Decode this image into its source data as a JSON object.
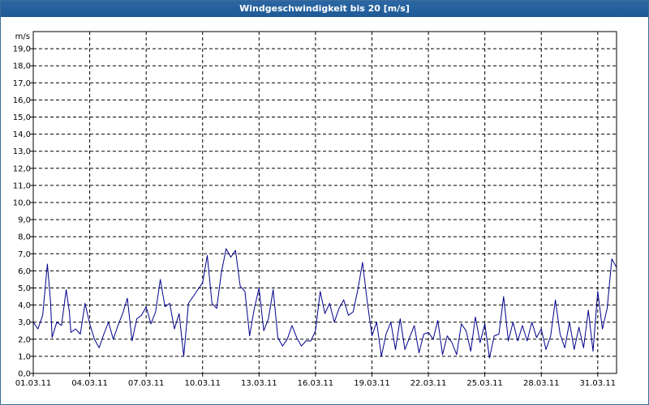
{
  "window": {
    "title": "Windgeschwindigkeit bis 20 [m/s]"
  },
  "colors": {
    "titlebar": "#1f5a96",
    "series": "#00008b",
    "grid": "#000000"
  },
  "chart_data": {
    "type": "line",
    "title": "Windgeschwindigkeit bis 20 [m/s]",
    "ylabel": "m/s",
    "xlabel": "",
    "ylim": [
      0,
      20
    ],
    "xlim": [
      "01.03.11",
      "01.04.11"
    ],
    "grid": true,
    "legend": "none",
    "yticks": [
      "0,0",
      "1,0",
      "2,0",
      "3,0",
      "4,0",
      "5,0",
      "6,0",
      "7,0",
      "8,0",
      "9,0",
      "10,0",
      "11,0",
      "12,0",
      "13,0",
      "14,0",
      "15,0",
      "16,0",
      "17,0",
      "18,0",
      "19,0"
    ],
    "xticks": [
      "01.03.11",
      "04.03.11",
      "07.03.11",
      "10.03.11",
      "13.03.11",
      "16.03.11",
      "19.03.11",
      "22.03.11",
      "25.03.11",
      "28.03.11",
      "31.03.11"
    ],
    "series": [
      {
        "x": [
          "01.03.11",
          "01.03.11",
          "01.03.11",
          "01.03.11",
          "01.03.11",
          "02.03.11",
          "02.03.11",
          "02.03.11",
          "02.03.11",
          "02.03.11",
          "03.03.11",
          "03.03.11",
          "03.03.11",
          "03.03.11",
          "04.03.11",
          "04.03.11",
          "04.03.11",
          "04.03.11",
          "05.03.11",
          "05.03.11",
          "05.03.11",
          "05.03.11",
          "06.03.11",
          "06.03.11",
          "06.03.11",
          "06.03.11",
          "07.03.11",
          "07.03.11",
          "07.03.11",
          "07.03.11",
          "08.03.11",
          "08.03.11",
          "08.03.11",
          "08.03.11",
          "09.03.11",
          "09.03.11",
          "09.03.11",
          "09.03.11",
          "10.03.11",
          "10.03.11",
          "10.03.11",
          "10.03.11",
          "11.03.11",
          "11.03.11",
          "11.03.11",
          "11.03.11",
          "12.03.11",
          "12.03.11",
          "12.03.11",
          "12.03.11",
          "13.03.11",
          "13.03.11",
          "13.03.11",
          "13.03.11",
          "14.03.11",
          "14.03.11",
          "14.03.11",
          "14.03.11",
          "15.03.11",
          "15.03.11",
          "15.03.11",
          "15.03.11",
          "16.03.11",
          "16.03.11",
          "16.03.11",
          "16.03.11",
          "17.03.11",
          "17.03.11",
          "17.03.11",
          "17.03.11",
          "18.03.11",
          "18.03.11",
          "18.03.11",
          "18.03.11",
          "19.03.11",
          "19.03.11",
          "19.03.11",
          "19.03.11",
          "20.03.11",
          "20.03.11",
          "20.03.11",
          "20.03.11",
          "21.03.11",
          "21.03.11",
          "21.03.11",
          "21.03.11",
          "22.03.11",
          "22.03.11",
          "22.03.11",
          "22.03.11",
          "23.03.11",
          "23.03.11",
          "23.03.11",
          "23.03.11",
          "24.03.11",
          "24.03.11",
          "24.03.11",
          "24.03.11",
          "25.03.11",
          "25.03.11",
          "25.03.11",
          "25.03.11",
          "26.03.11",
          "26.03.11",
          "26.03.11",
          "26.03.11",
          "27.03.11",
          "27.03.11",
          "27.03.11",
          "27.03.11",
          "28.03.11",
          "28.03.11",
          "28.03.11",
          "28.03.11",
          "29.03.11",
          "29.03.11",
          "29.03.11",
          "29.03.11",
          "30.03.11",
          "30.03.11",
          "30.03.11",
          "30.03.11",
          "31.03.11",
          "31.03.11",
          "31.03.11",
          "31.03.11",
          "01.04.11"
        ],
        "hours": [
          0,
          6,
          12,
          18,
          22,
          0,
          6,
          12,
          18,
          22,
          0,
          6,
          12,
          18,
          0,
          6,
          12,
          18,
          0,
          6,
          12,
          18,
          0,
          6,
          12,
          18,
          0,
          6,
          12,
          18,
          0,
          6,
          12,
          18,
          0,
          6,
          12,
          18,
          0,
          6,
          12,
          18,
          0,
          6,
          12,
          18,
          0,
          6,
          12,
          18,
          0,
          6,
          12,
          18,
          0,
          6,
          12,
          18,
          0,
          6,
          12,
          18,
          0,
          6,
          12,
          18,
          0,
          6,
          12,
          18,
          0,
          6,
          12,
          18,
          0,
          6,
          12,
          18,
          0,
          6,
          12,
          18,
          0,
          6,
          12,
          18,
          0,
          6,
          12,
          18,
          0,
          6,
          12,
          18,
          0,
          6,
          12,
          18,
          0,
          6,
          12,
          18,
          0,
          6,
          12,
          18,
          0,
          6,
          12,
          18,
          0,
          6,
          12,
          18,
          0,
          6,
          12,
          18,
          0,
          6,
          12,
          18,
          0,
          6,
          12,
          18,
          0
        ],
        "values": [
          3.0,
          2.6,
          3.4,
          6.4,
          4.2,
          2.1,
          3.0,
          2.8,
          4.9,
          3.6,
          2.4,
          2.6,
          2.3,
          4.1,
          2.9,
          2.0,
          1.5,
          2.3,
          3.0,
          2.0,
          2.8,
          3.5,
          4.4,
          1.9,
          3.2,
          3.4,
          3.9,
          2.9,
          3.6,
          5.5,
          3.9,
          4.1,
          2.6,
          3.5,
          1.0,
          4.1,
          4.5,
          4.9,
          5.3,
          6.9,
          4.1,
          3.8,
          5.9,
          7.3,
          6.8,
          7.2,
          5.1,
          4.8,
          2.2,
          3.8,
          5.0,
          2.5,
          3.2,
          4.9,
          2.1,
          1.6,
          2.0,
          2.8,
          2.1,
          1.6,
          1.9,
          1.9,
          2.5,
          4.8,
          3.5,
          4.1,
          3.0,
          3.8,
          4.3,
          3.4,
          3.6,
          4.9,
          6.5,
          4.2,
          2.2,
          3.0,
          1.0,
          2.3,
          3.0,
          1.4,
          3.2,
          1.4,
          2.1,
          2.8,
          1.2,
          2.3,
          2.4,
          2.0,
          3.1,
          1.1,
          2.2,
          1.8,
          1.1,
          2.9,
          2.5,
          1.3,
          3.3,
          1.8,
          2.9,
          0.9,
          2.2,
          2.3,
          4.5,
          1.9,
          3.0,
          1.9,
          2.8,
          1.9,
          3.0,
          2.1,
          2.6,
          1.4,
          2.2,
          4.3,
          2.3,
          1.5,
          3.0,
          1.4,
          2.7,
          1.5,
          3.7,
          1.3,
          4.8,
          2.6,
          3.8,
          6.7,
          6.2
        ]
      }
    ]
  }
}
